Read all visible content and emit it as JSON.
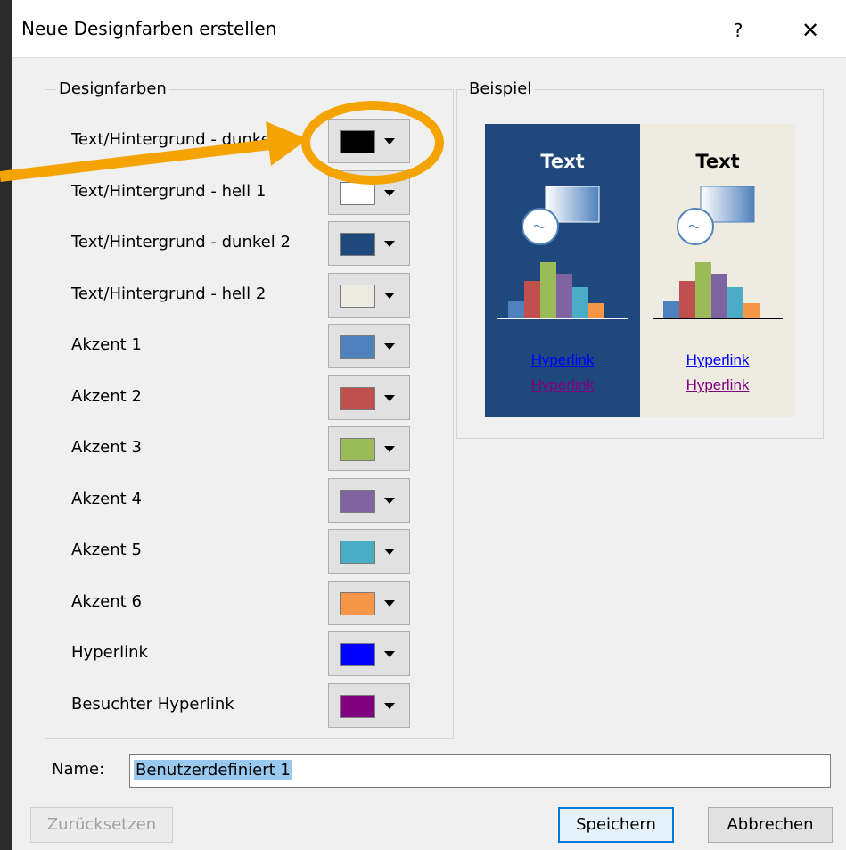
{
  "dialog": {
    "title": "Neue Designfarben erstellen",
    "help_label": "?",
    "close_label": "✕"
  },
  "theme_colors": {
    "legend": "Designfarben",
    "rows": [
      {
        "label": "Text/Hintergrund - dunkel 1",
        "color": "#000000"
      },
      {
        "label": "Text/Hintergrund - hell 1",
        "color": "#ffffff"
      },
      {
        "label": "Text/Hintergrund - dunkel 2",
        "color": "#1f497d"
      },
      {
        "label": "Text/Hintergrund - hell 2",
        "color": "#eeece1"
      },
      {
        "label": "Akzent 1",
        "color": "#4f81bd"
      },
      {
        "label": "Akzent 2",
        "color": "#c0504d"
      },
      {
        "label": "Akzent 3",
        "color": "#9bbb59"
      },
      {
        "label": "Akzent 4",
        "color": "#8064a2"
      },
      {
        "label": "Akzent 5",
        "color": "#4bacc6"
      },
      {
        "label": "Akzent 6",
        "color": "#f79646"
      },
      {
        "label": "Hyperlink",
        "color": "#0000ff"
      },
      {
        "label": "Besuchter Hyperlink",
        "color": "#800080"
      }
    ]
  },
  "sample": {
    "legend": "Beispiel",
    "dark_title": "Text",
    "light_title": "Text",
    "hyperlink": "Hyperlink",
    "visited_hyperlink": "Hyperlink"
  },
  "name_field": {
    "label": "Name:",
    "value": "Benutzerdefiniert 1"
  },
  "buttons": {
    "reset": "Zurücksetzen",
    "save": "Speichern",
    "cancel": "Abbrechen"
  },
  "annotation": {
    "color": "#f5a300"
  }
}
